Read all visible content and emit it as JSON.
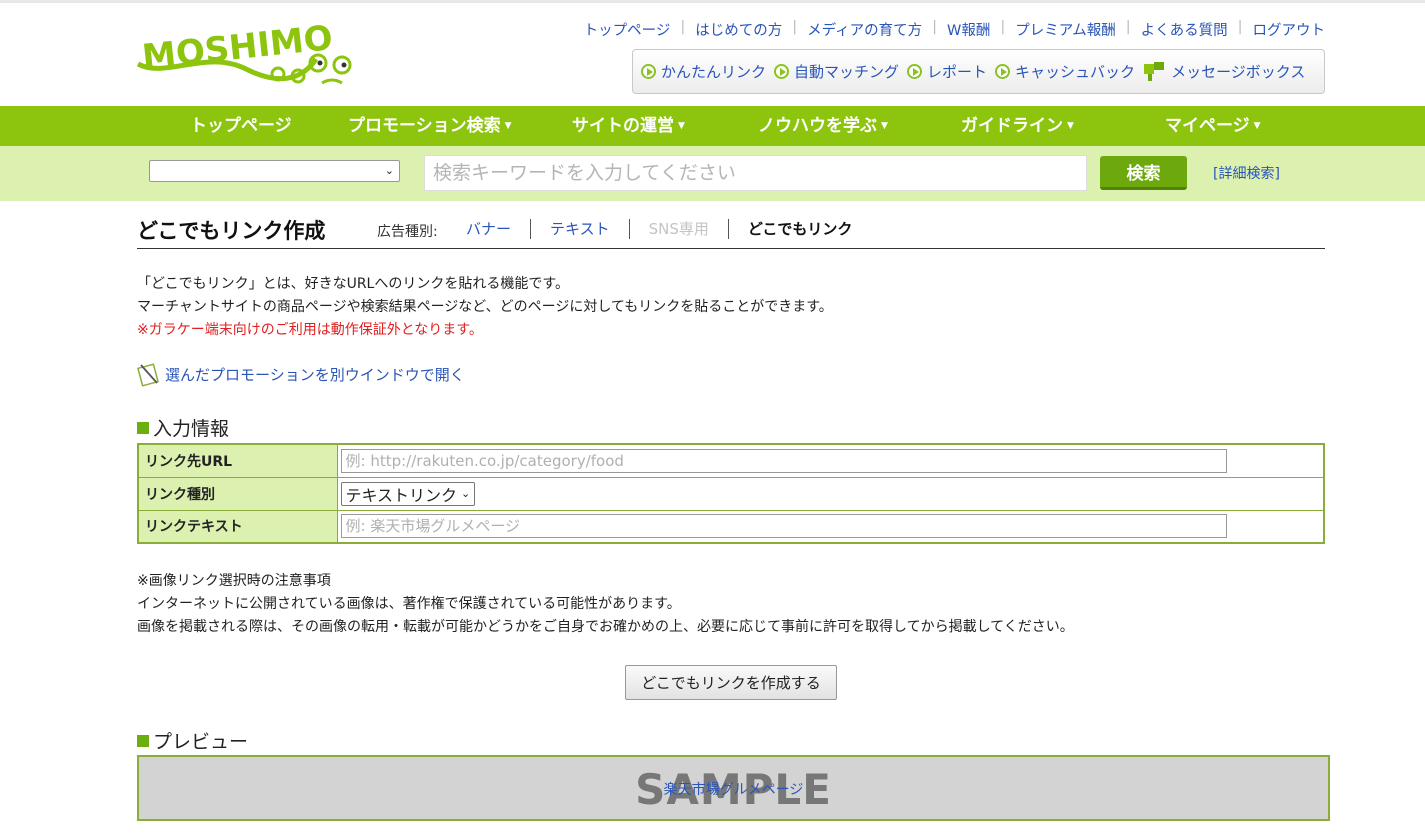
{
  "header": {
    "logo_text": "MOSHIMO",
    "top_links": [
      "トップページ",
      "はじめての方",
      "メディアの育て方",
      "W報酬",
      "プレミアム報酬",
      "よくある質問",
      "ログアウト"
    ],
    "quick_links": [
      "かんたんリンク",
      "自動マッチング",
      "レポート",
      "キャッシュバック"
    ],
    "message_box": "メッセージボックス"
  },
  "nav": {
    "items": [
      "トップページ",
      "プロモーション検索",
      "サイトの運営",
      "ノウハウを学ぶ",
      "ガイドライン",
      "マイページ"
    ]
  },
  "search": {
    "category_value": "",
    "placeholder": "検索キーワードを入力してください",
    "button": "検索",
    "advanced": "[詳細検索]"
  },
  "page": {
    "title": "どこでもリンク作成",
    "ad_type_label": "広告種別:",
    "ad_tabs": [
      "バナー",
      "テキスト",
      "SNS専用",
      "どこでもリンク"
    ],
    "desc_line1": "「どこでもリンク」とは、好きなURLへのリンクを貼れる機能です。",
    "desc_line2": "マーチャントサイトの商品ページや検索結果ページなど、どのページに対してもリンクを貼ることができます。",
    "warning": "※ガラケー端末向けのご利用は動作保証外となります。",
    "open_window": "選んだプロモーションを別ウインドウで開く"
  },
  "form": {
    "heading": "入力情報",
    "url_label": "リンク先URL",
    "url_placeholder": "例: http://rakuten.co.jp/category/food",
    "type_label": "リンク種別",
    "type_value": "テキストリンク",
    "text_label": "リンクテキスト",
    "text_placeholder": "例: 楽天市場グルメページ"
  },
  "notes": {
    "line1": "※画像リンク選択時の注意事項",
    "line2": "インターネットに公開されている画像は、著作権で保護されている可能性があります。",
    "line3": "画像を掲載される際は、その画像の転用・転載が可能かどうかをご自身でお確かめの上、必要に応じて事前に許可を取得してから掲載してください。"
  },
  "create_button": "どこでもリンクを作成する",
  "preview": {
    "heading": "プレビュー",
    "sample": "SAMPLE",
    "link_text": "楽天市場グルメページ"
  },
  "colors": {
    "brand_green": "#8cc40e",
    "light_green": "#dcf0b0",
    "link_blue": "#2a55b8",
    "warning_red": "#e02020"
  }
}
